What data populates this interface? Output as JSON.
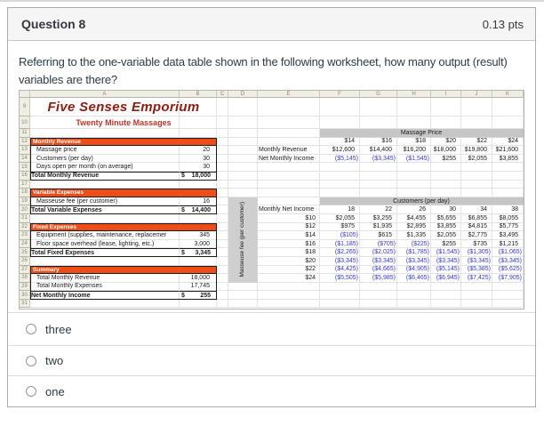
{
  "header": {
    "title": "Question 8",
    "points": "0.13 pts"
  },
  "question": {
    "text": "Referring to the one-variable data table shown in the following worksheet, how many output (result) variables are there?"
  },
  "options": [
    {
      "label": "three"
    },
    {
      "label": "two"
    },
    {
      "label": "one"
    }
  ],
  "spreadsheet": {
    "column_letters": [
      "A",
      "B",
      "C",
      "D",
      "E",
      "F",
      "G",
      "H",
      "I",
      "J",
      "K"
    ],
    "row_numbers": [
      9,
      10,
      11,
      12,
      13,
      14,
      15,
      16,
      17,
      18,
      19,
      20,
      21,
      22,
      23,
      24,
      25,
      26,
      27,
      28,
      29,
      30,
      31
    ],
    "title": "Five Senses Emporium",
    "subtitle": "Twenty Minute Massages",
    "left_rows": [
      {
        "n": 12,
        "type": "section",
        "label": "Monthly Revenue"
      },
      {
        "n": 13,
        "type": "item",
        "label": "Massage price",
        "value": "20"
      },
      {
        "n": 14,
        "type": "item",
        "label": "Customers (per day)",
        "value": "30"
      },
      {
        "n": 15,
        "type": "item",
        "label": "Days open per month (on average)",
        "value": "30"
      },
      {
        "n": 16,
        "type": "total",
        "label": "Total Monthly Revenue",
        "dollar": "$",
        "value": "18,000"
      },
      {
        "n": 18,
        "type": "section",
        "label": "Variable Expenses"
      },
      {
        "n": 19,
        "type": "item",
        "label": "Masseuse fee (per customer)",
        "value": "16"
      },
      {
        "n": 20,
        "type": "total",
        "label": "Total Variable Expenses",
        "dollar": "$",
        "value": "14,400"
      },
      {
        "n": 22,
        "type": "section",
        "label": "Fixed Expenses"
      },
      {
        "n": 23,
        "type": "item",
        "label": "Equipment (supplies, maintenance, replacemer",
        "value": "345"
      },
      {
        "n": 24,
        "type": "item",
        "label": "Floor space overhead (lease, lighting, etc.)",
        "value": "3,000"
      },
      {
        "n": 25,
        "type": "total",
        "label": "Total Fixed Expenses",
        "dollar": "$",
        "value": "3,345"
      },
      {
        "n": 27,
        "type": "section",
        "label": "Summary"
      },
      {
        "n": 28,
        "type": "item",
        "label": "Total Monthly Revenue",
        "value": "18,000"
      },
      {
        "n": 29,
        "type": "item",
        "label": "Total Monthly Expenses",
        "value": "17,745"
      },
      {
        "n": 30,
        "type": "total",
        "label": "Net Monthly Income",
        "dollar": "$",
        "value": "255"
      }
    ],
    "one_var_table": {
      "header": "Massage Price",
      "col_values": [
        "$14",
        "$16",
        "$18",
        "$20",
        "$22",
        "$24"
      ],
      "rows": [
        {
          "label": "Monthly Revenue",
          "values": [
            "$12,600",
            "$14,400",
            "$16,200",
            "$18,000",
            "$19,800",
            "$21,600"
          ]
        },
        {
          "label": "Net Monthly Income",
          "values": [
            "($5,145)",
            "($3,345)",
            "($1,545)",
            "$255",
            "$2,055",
            "$3,855"
          ]
        }
      ]
    },
    "two_var_table": {
      "header": "Customers (per day)",
      "corner_label": "Monthly Net Income",
      "row_axis_label": "Masseuse fee (per customer)",
      "col_values": [
        "18",
        "22",
        "26",
        "30",
        "34",
        "38"
      ],
      "row_values": [
        "$10",
        "$12",
        "$14",
        "$16",
        "$18",
        "$20",
        "$22",
        "$24"
      ],
      "cells": [
        [
          "$2,055",
          "$3,255",
          "$4,455",
          "$5,655",
          "$6,855",
          "$8,055"
        ],
        [
          "$975",
          "$1,935",
          "$2,895",
          "$3,855",
          "$4,815",
          "$5,775"
        ],
        [
          "($105)",
          "$615",
          "$1,335",
          "$2,055",
          "$2,775",
          "$3,495"
        ],
        [
          "($1,185)",
          "($705)",
          "($225)",
          "$255",
          "$735",
          "$1,215"
        ],
        [
          "($2,265)",
          "($2,025)",
          "($1,785)",
          "($1,545)",
          "($1,305)",
          "($1,065)"
        ],
        [
          "($3,345)",
          "($3,345)",
          "($3,345)",
          "($3,345)",
          "($3,345)",
          "($3,345)"
        ],
        [
          "($4,425)",
          "($4,665)",
          "($4,905)",
          "($5,145)",
          "($5,385)",
          "($5,625)"
        ],
        [
          "($5,505)",
          "($5,985)",
          "($6,465)",
          "($6,945)",
          "($7,425)",
          "($7,905)"
        ]
      ]
    },
    "colors": {
      "accent_orange": "#ee4d17",
      "negative_blue": "#3737ce",
      "band_gray": "#c6c6c6",
      "strip_gray": "#cfcfcf",
      "title_red": "#8e1a10",
      "subtitle_red": "#c23527"
    }
  }
}
